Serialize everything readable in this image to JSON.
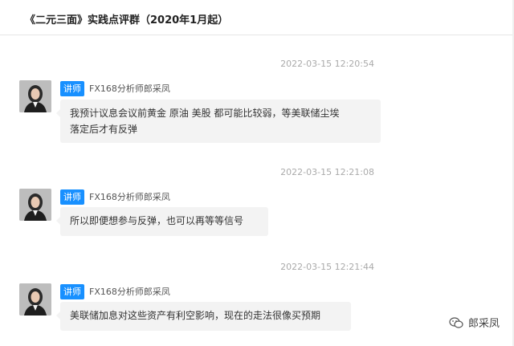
{
  "header": {
    "title": "《二元三面》实践点评群（2020年1月起）"
  },
  "messages": [
    {
      "timestamp": "2022-03-15 12:20:54",
      "badge": "讲师",
      "name": "FX168分析师郎采凤",
      "text_lines": [
        "我预计议息会议前黄金 原油 美股 都可能比较弱，等美联储尘埃",
        "落定后才有反弹"
      ]
    },
    {
      "timestamp": "2022-03-15 12:21:08",
      "badge": "讲师",
      "name": "FX168分析师郎采凤",
      "text_lines": [
        "所以即便想参与反弹，也可以再等等信号"
      ]
    },
    {
      "timestamp": "2022-03-15 12:21:44",
      "badge": "讲师",
      "name": "FX168分析师郎采凤",
      "text_lines": [
        "美联储加息对这些资产有利空影响，现在的走法很像买预期"
      ]
    }
  ],
  "watermark": {
    "icon": "wechat-official-account-icon",
    "label": "郎采凤"
  }
}
